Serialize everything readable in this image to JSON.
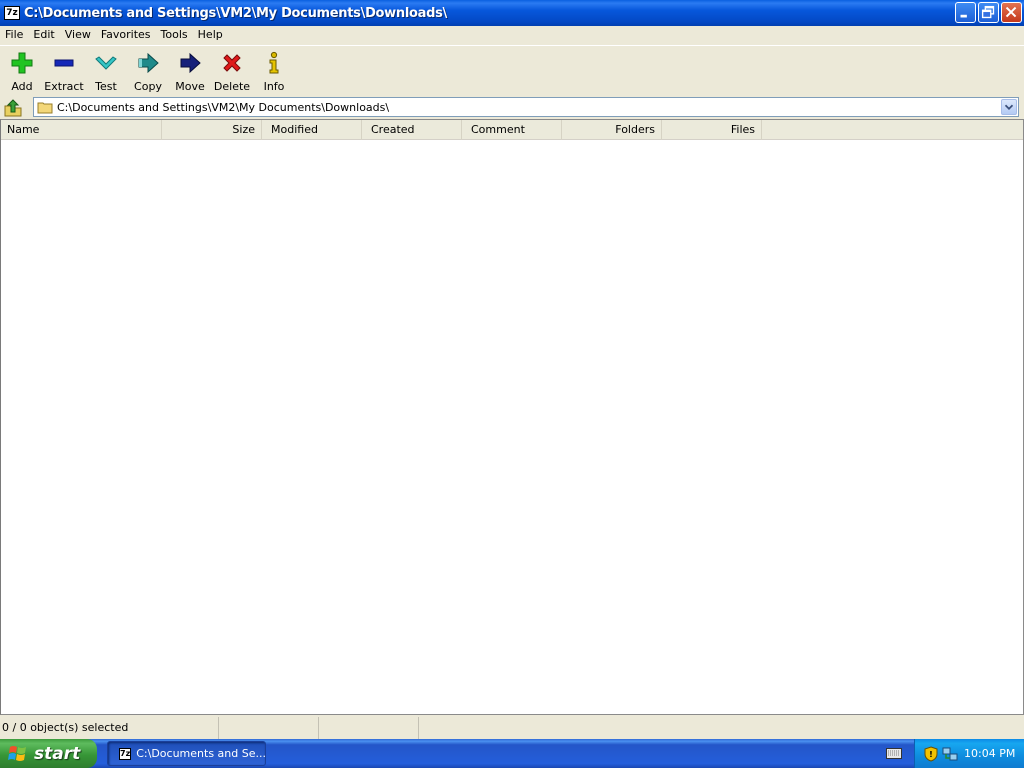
{
  "window": {
    "title": "C:\\Documents and Settings\\VM2\\My Documents\\Downloads\\",
    "app_icon_text": "7z",
    "controls": [
      "minimize-icon",
      "restore-icon",
      "close-icon"
    ]
  },
  "menu": [
    "File",
    "Edit",
    "View",
    "Favorites",
    "Tools",
    "Help"
  ],
  "toolbar": {
    "add": "Add",
    "extract": "Extract",
    "test": "Test",
    "copy": "Copy",
    "move": "Move",
    "delete": "Delete",
    "info": "Info"
  },
  "address": {
    "path": "C:\\Documents and Settings\\VM2\\My Documents\\Downloads\\"
  },
  "columns": {
    "name": "Name",
    "size": "Size",
    "modified": "Modified",
    "created": "Created",
    "comment": "Comment",
    "folders": "Folders",
    "files": "Files"
  },
  "status": {
    "selection": "0 / 0 object(s) selected",
    "cell2": "",
    "cell3": ""
  },
  "taskbar": {
    "start": "start",
    "task_icon_text": "7z",
    "task_label": "C:\\Documents and Se...",
    "clock": "10:04 PM"
  },
  "colors": {
    "titlebar": "#0757db",
    "chrome": "#ece9d8",
    "taskbar": "#245edb",
    "start": "#379637"
  }
}
